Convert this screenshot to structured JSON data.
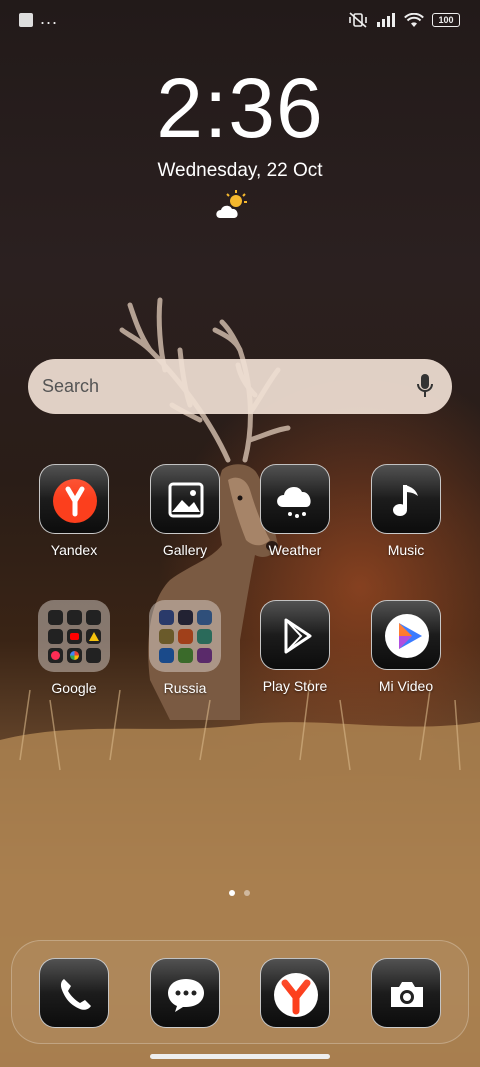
{
  "status_bar": {
    "dots": "...",
    "battery": "100"
  },
  "clock": {
    "time": "2:36",
    "date": "Wednesday, 22 Oct"
  },
  "search": {
    "placeholder": "Search"
  },
  "apps": {
    "yandex": "Yandex",
    "gallery": "Gallery",
    "weather": "Weather",
    "music": "Music",
    "google": "Google",
    "russia": "Russia",
    "play_store": "Play Store",
    "mi_video": "Mi Video"
  },
  "page_indicator": {
    "pages": 2,
    "current": 1
  },
  "icons": {
    "dock": [
      "phone-icon",
      "messages-icon",
      "yandex-browser-icon",
      "camera-icon"
    ]
  },
  "colors": {
    "yandex_red": "#fc3f1d",
    "search_bg": "#f0e0d4"
  }
}
